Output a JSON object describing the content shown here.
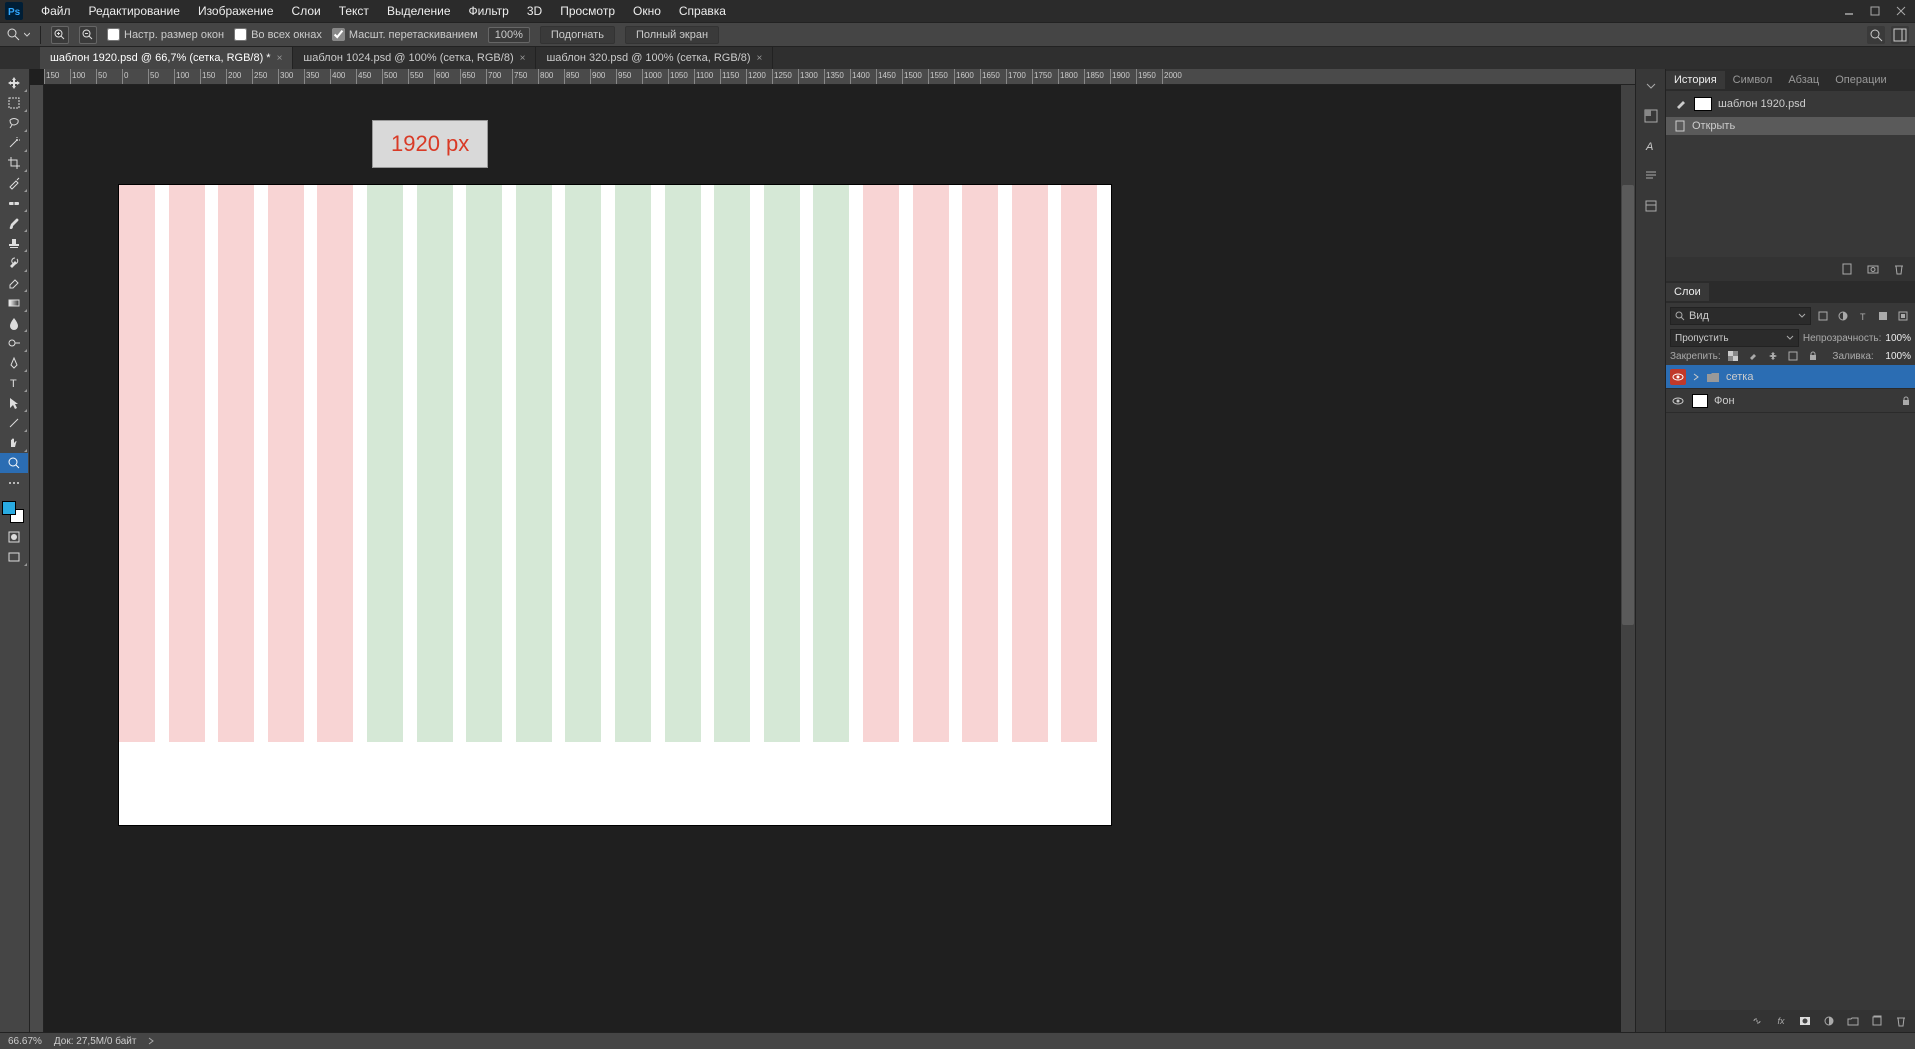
{
  "app": {
    "logo_text": "Ps"
  },
  "menu": [
    "Файл",
    "Редактирование",
    "Изображение",
    "Слои",
    "Текст",
    "Выделение",
    "Фильтр",
    "3D",
    "Просмотр",
    "Окно",
    "Справка"
  ],
  "options": {
    "resize_windows": "Настр. размер окон",
    "all_windows": "Во всех окнах",
    "scrub_zoom": "Масшт. перетаскиванием",
    "scrub_checked": true,
    "zoom_value": "100%",
    "fit": "Подогнать",
    "fullscreen": "Полный экран"
  },
  "tabs": [
    {
      "title": "шаблон 1920.psd @ 66,7% (сетка, RGB/8) *",
      "active": true
    },
    {
      "title": "шаблон 1024.psd @ 100% (сетка, RGB/8)",
      "active": false
    },
    {
      "title": "шаблон 320.psd @ 100% (сетка, RGB/8)",
      "active": false
    }
  ],
  "ruler_ticks": [
    "150",
    "100",
    "50",
    "0",
    "50",
    "100",
    "150",
    "200",
    "250",
    "300",
    "350",
    "400",
    "450",
    "500",
    "550",
    "600",
    "650",
    "700",
    "750",
    "800",
    "850",
    "900",
    "950",
    "1000",
    "1050",
    "1100",
    "1150",
    "1200",
    "1250",
    "1300",
    "1350",
    "1400",
    "1450",
    "1500",
    "1550",
    "1600",
    "1650",
    "1700",
    "1750",
    "1800",
    "1850",
    "1900",
    "1950",
    "2000"
  ],
  "canvas_label": "1920 px",
  "panels": {
    "history_tabs": [
      "История",
      "Символ",
      "Абзац",
      "Операции"
    ],
    "history_doc": "шаблон 1920.psd",
    "history_step": "Открыть",
    "layers_tab": "Слои",
    "kind_label": "Вид",
    "blend_mode": "Пропустить",
    "opacity_label": "Непрозрачность:",
    "opacity_value": "100%",
    "lock_label": "Закрепить:",
    "fill_label": "Заливка:",
    "fill_value": "100%",
    "layers": [
      {
        "name": "сетка",
        "selected": true,
        "folder": true
      },
      {
        "name": "Фон",
        "selected": false,
        "locked": true
      }
    ]
  },
  "status": {
    "zoom": "66.67%",
    "doc": "Док: 27,5M/0 байт"
  },
  "colors": {
    "pink": "#f8d4d4",
    "green": "#d5e8d6",
    "fg": "#29abe2"
  }
}
